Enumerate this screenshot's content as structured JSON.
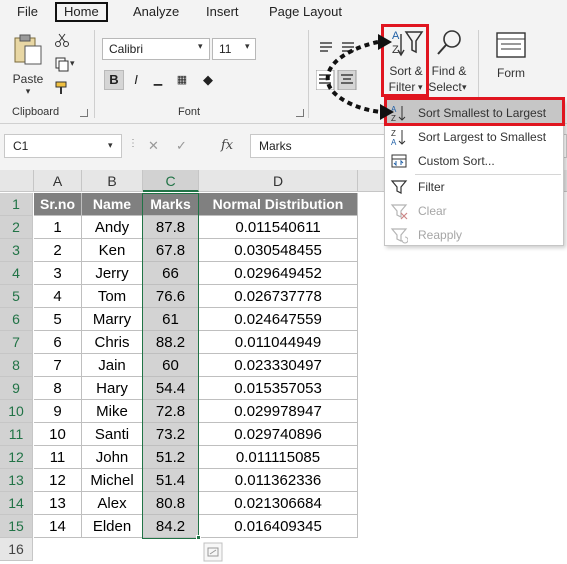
{
  "menu": {
    "items": [
      "File",
      "Home",
      "Analyze",
      "Insert",
      "Page Layout"
    ]
  },
  "ribbon": {
    "clipboard": {
      "paste_label": "Paste",
      "group_label": "Clipboard"
    },
    "font": {
      "font_name": "Calibri",
      "font_size": "11",
      "bold": "B",
      "italic": "I",
      "group_label": "Font"
    },
    "sort_filter_label_1": "Sort &",
    "sort_filter_label_2": "Filter",
    "find_select_label_1": "Find &",
    "find_select_label_2": "Select",
    "form_label": "Form"
  },
  "formula_bar": {
    "name_box": "C1",
    "fx": "fx",
    "cancel": "✕",
    "enter": "✓",
    "content": "Marks"
  },
  "sheet": {
    "columns": [
      "A",
      "B",
      "C",
      "D"
    ],
    "headers": [
      "Sr.no",
      "Name",
      "Marks",
      "Normal  Distribution"
    ],
    "rows": [
      [
        "1",
        "Andy",
        "87.8",
        "0.011540611"
      ],
      [
        "2",
        "Ken",
        "67.8",
        "0.030548455"
      ],
      [
        "3",
        "Jerry",
        "66",
        "0.029649452"
      ],
      [
        "4",
        "Tom",
        "76.6",
        "0.026737778"
      ],
      [
        "5",
        "Marry",
        "61",
        "0.024647559"
      ],
      [
        "6",
        "Chris",
        "88.2",
        "0.011044949"
      ],
      [
        "7",
        "Jain",
        "60",
        "0.023330497"
      ],
      [
        "8",
        "Hary",
        "54.4",
        "0.015357053"
      ],
      [
        "9",
        "Mike",
        "72.8",
        "0.029978947"
      ],
      [
        "10",
        "Santi",
        "73.2",
        "0.029740896"
      ],
      [
        "11",
        "John",
        "51.2",
        "0.011115085"
      ],
      [
        "12",
        "Michel",
        "51.4",
        "0.011362336"
      ],
      [
        "13",
        "Alex",
        "80.8",
        "0.021306684"
      ],
      [
        "14",
        "Elden",
        "84.2",
        "0.016409345"
      ]
    ],
    "row_numbers": [
      "1",
      "2",
      "3",
      "4",
      "5",
      "6",
      "7",
      "8",
      "9",
      "10",
      "11",
      "12",
      "13",
      "14",
      "15",
      "16"
    ]
  },
  "dropdown": {
    "items": [
      {
        "label": "Sort Smallest to Largest",
        "icon": "sort-ascending-icon",
        "enabled": true
      },
      {
        "label": "Sort Largest to Smallest",
        "icon": "sort-descending-icon",
        "enabled": true
      },
      {
        "label": "Custom Sort...",
        "icon": "custom-sort-icon",
        "enabled": true
      },
      {
        "label": "Filter",
        "icon": "filter-icon",
        "enabled": true
      },
      {
        "label": "Clear",
        "icon": "clear-filter-icon",
        "enabled": false
      },
      {
        "label": "Reapply",
        "icon": "reapply-icon",
        "enabled": false
      }
    ]
  },
  "colors": {
    "header_fill": "#808080",
    "selected_fill": "#d3d3d3",
    "accent": "#217346",
    "annotation": "#e0151f"
  }
}
